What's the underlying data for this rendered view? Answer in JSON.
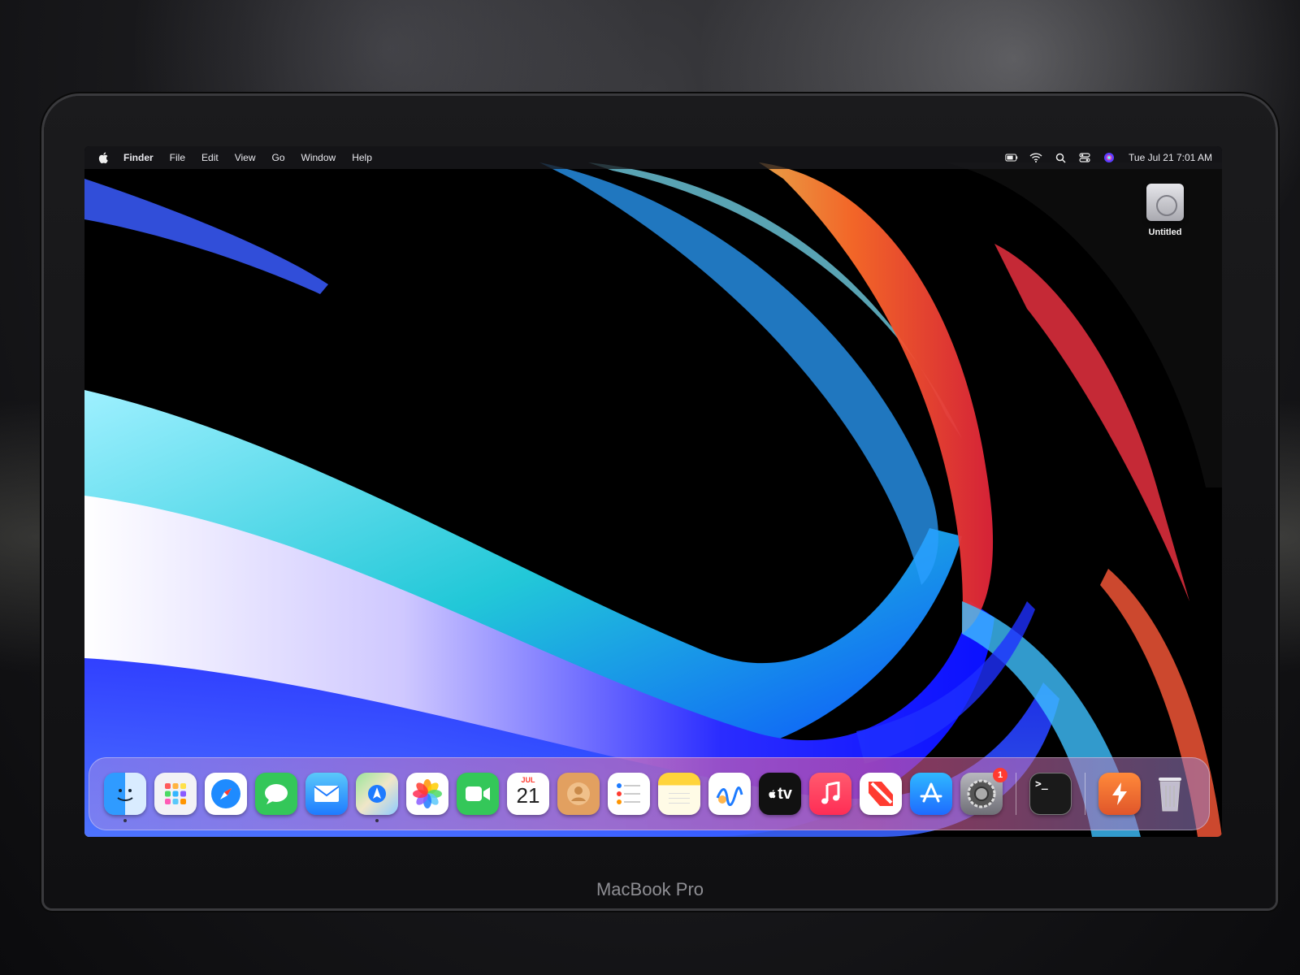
{
  "menubar": {
    "items": [
      {
        "label": "Finder",
        "app": true
      },
      {
        "label": "File"
      },
      {
        "label": "Edit"
      },
      {
        "label": "View"
      },
      {
        "label": "Go"
      },
      {
        "label": "Window"
      },
      {
        "label": "Help"
      }
    ],
    "status_icons": [
      "battery-icon",
      "wifi-icon",
      "spotlight-search-icon",
      "control-center-icon",
      "siri-icon"
    ],
    "clock": "Tue Jul 21  7:01 AM"
  },
  "desktop": {
    "icons": [
      {
        "label": "Untitled",
        "icon": "drive-icon"
      }
    ]
  },
  "dock": {
    "calendar": {
      "month": "JUL",
      "day": "21"
    },
    "settings_badge": "1",
    "terminal_glyph": ">_",
    "tv_label": "tv"
  },
  "device": {
    "brand": "MacBook Pro"
  },
  "colors": {
    "menubar_bg": "#19191e",
    "badge_red": "#ff3b30"
  }
}
